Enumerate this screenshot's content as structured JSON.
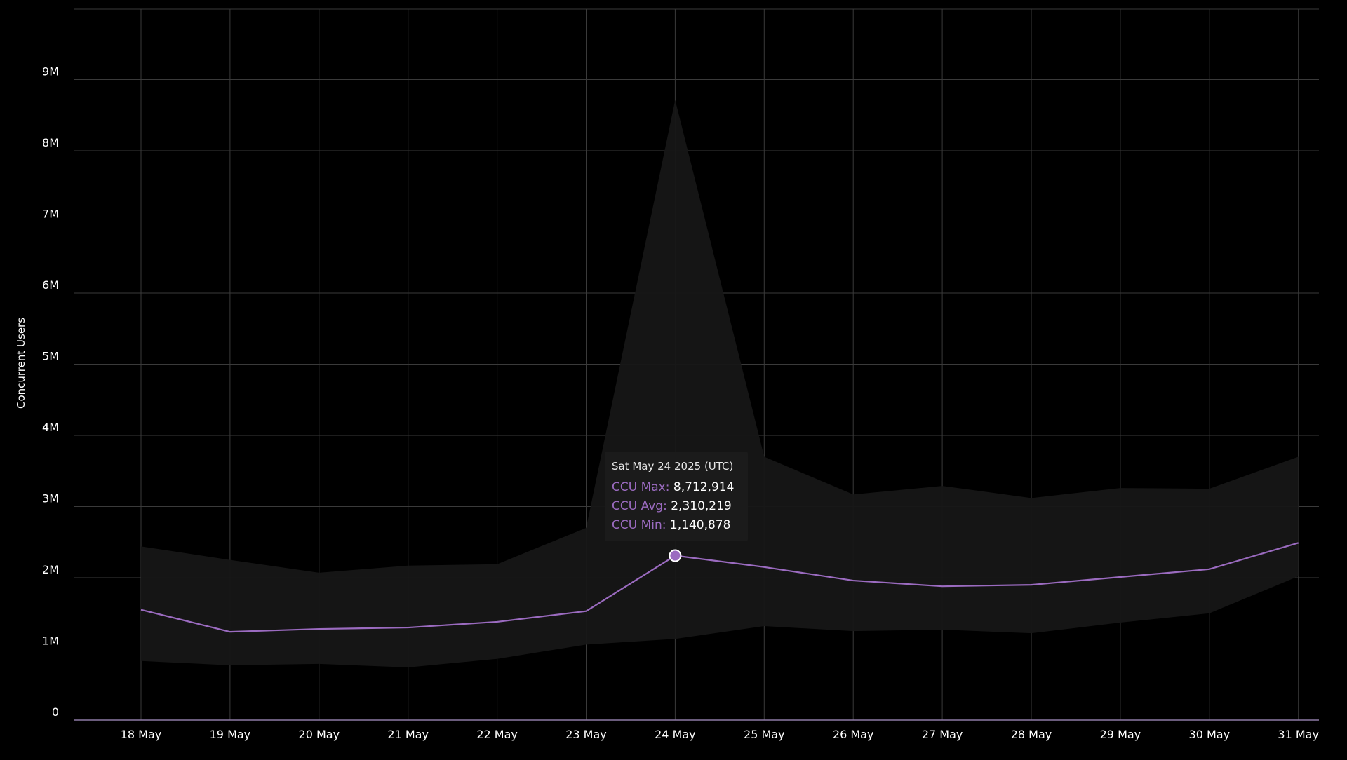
{
  "chart_data": {
    "type": "line",
    "ylabel": "Concurrent Users",
    "xlabel": "",
    "title": "",
    "categories": [
      "18 May",
      "19 May",
      "20 May",
      "21 May",
      "22 May",
      "23 May",
      "24 May",
      "25 May",
      "26 May",
      "27 May",
      "28 May",
      "29 May",
      "30 May",
      "31 May"
    ],
    "y_ticks": [
      "0",
      "1M",
      "2M",
      "3M",
      "4M",
      "5M",
      "6M",
      "7M",
      "8M",
      "9M"
    ],
    "ylim": [
      0,
      10000000
    ],
    "grid": true,
    "series": [
      {
        "name": "CCU Max",
        "kind": "range-upper",
        "values": [
          2440000,
          2250000,
          2070000,
          2170000,
          2190000,
          2700000,
          8712914,
          3700000,
          3170000,
          3290000,
          3120000,
          3260000,
          3250000,
          3700000
        ]
      },
      {
        "name": "CCU Avg",
        "kind": "line",
        "values": [
          1550000,
          1240000,
          1280000,
          1300000,
          1380000,
          1530000,
          2310219,
          2150000,
          1960000,
          1880000,
          1900000,
          2010000,
          2120000,
          2490000
        ]
      },
      {
        "name": "CCU Min",
        "kind": "range-lower",
        "values": [
          830000,
          770000,
          790000,
          740000,
          860000,
          1060000,
          1140878,
          1320000,
          1250000,
          1270000,
          1220000,
          1370000,
          1500000,
          2020000
        ]
      }
    ],
    "colors": {
      "line": "#9b6bc0",
      "range": "#161616",
      "grid": "#3a3a3a",
      "axis": "#8d7aa6"
    },
    "tooltip": {
      "index": 6,
      "date": "Sat May 24 2025 (UTC)",
      "rows": [
        {
          "label": "CCU Max",
          "value": "8,712,914"
        },
        {
          "label": "CCU Avg",
          "value": "2,310,219"
        },
        {
          "label": "CCU Min",
          "value": "1,140,878"
        }
      ]
    }
  }
}
